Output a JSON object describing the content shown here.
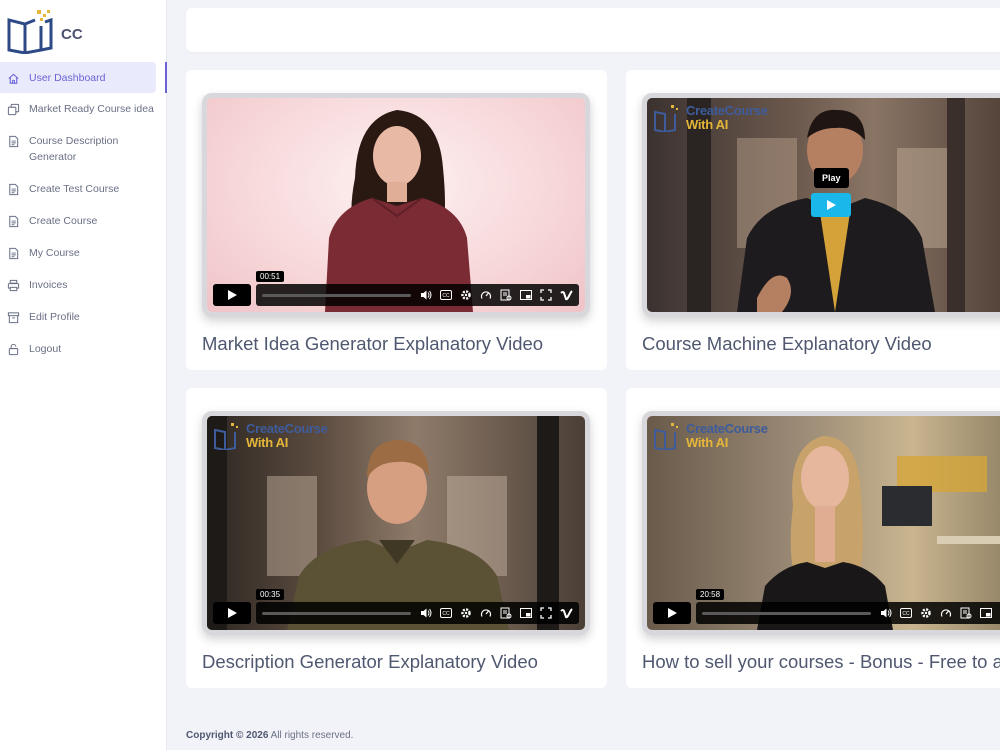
{
  "app": {
    "logo_text": "CC"
  },
  "sidebar": {
    "items": [
      {
        "label": "User Dashboard",
        "icon": "home-icon"
      },
      {
        "label": "Market Ready Course idea",
        "icon": "copy-icon"
      },
      {
        "label": "Course Description Generator",
        "icon": "document-icon"
      },
      {
        "label": "Create Test Course",
        "icon": "document-icon"
      },
      {
        "label": "Create Course",
        "icon": "document-icon"
      },
      {
        "label": "My Course",
        "icon": "document-icon"
      },
      {
        "label": "Invoices",
        "icon": "printer-icon"
      },
      {
        "label": "Edit Profile",
        "icon": "archive-icon"
      },
      {
        "label": "Logout",
        "icon": "lock-icon"
      }
    ]
  },
  "videos": [
    {
      "title": "Market Idea Generator Explanatory Video",
      "time": "00:51"
    },
    {
      "title": "Course Machine Explanatory Video",
      "play_tooltip": "Play",
      "logo_line1": "CreateCourse",
      "logo_line2_a": "With ",
      "logo_line2_b": "AI"
    },
    {
      "title": "Description Generator Explanatory Video",
      "time": "00:35",
      "logo_line1": "CreateCourse",
      "logo_line2_a": "With ",
      "logo_line2_b": "AI"
    },
    {
      "title": "How to sell your courses - Bonus - Free to a",
      "time": "20:58",
      "logo_line1": "CreateCourse",
      "logo_line2_a": "With ",
      "logo_line2_b": "AI"
    }
  ],
  "footer": {
    "copyright": "Copyright © 2026",
    "rights": " All rights reserved."
  },
  "colors": {
    "accent": "#6a63d6",
    "vimeo_blue": "#1ab7ea",
    "logo_blue": "#3e5c9c",
    "logo_gold": "#e4b63a"
  }
}
